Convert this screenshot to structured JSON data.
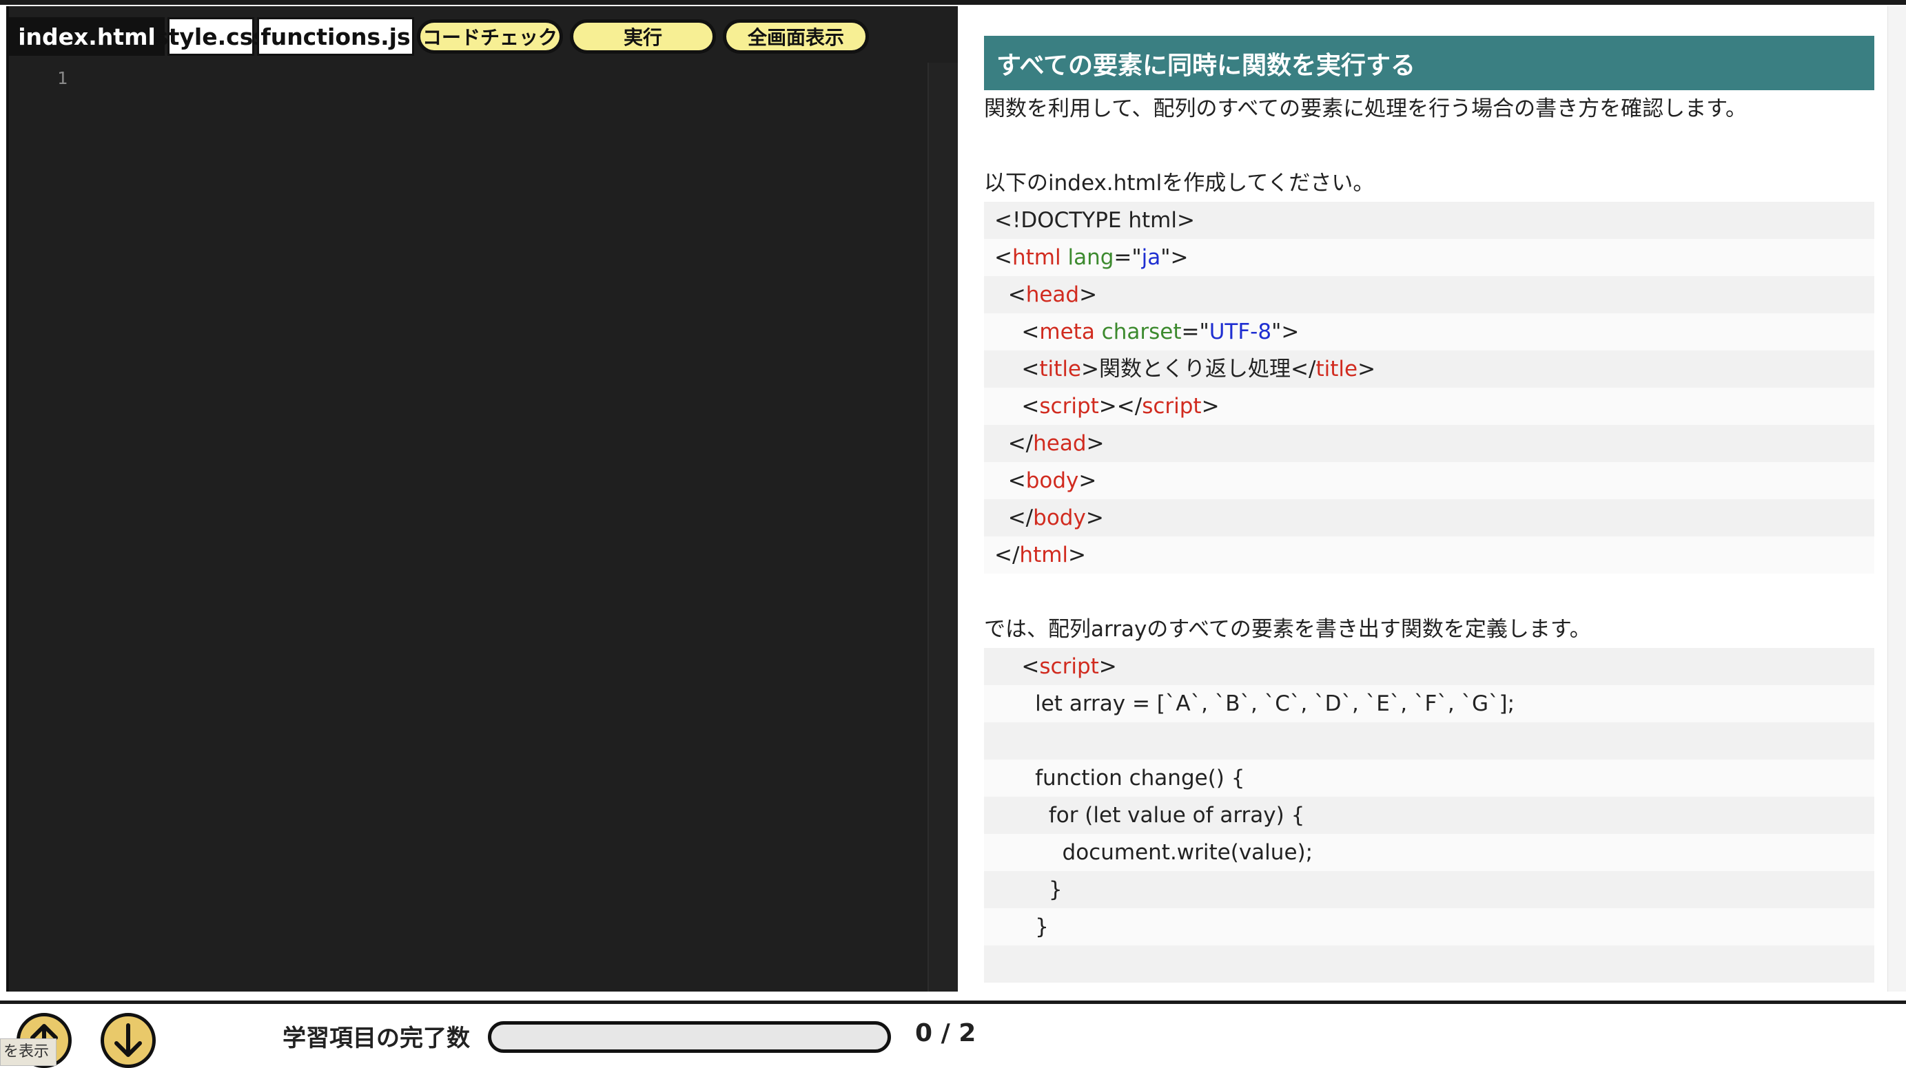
{
  "editor": {
    "tabs": [
      {
        "label": "index.html",
        "active": true
      },
      {
        "label": "style.css",
        "active": false
      },
      {
        "label": "functions.js",
        "active": false
      }
    ],
    "buttons": {
      "code_check": "コードチェック",
      "run": "実行",
      "fullscreen": "全画面表示"
    },
    "line_number": "1"
  },
  "doc": {
    "heading": "すべての要素に同時に関数を実行する",
    "intro": "関数を利用して、配列のすべての要素に処理を行う場合の書き方を確認します。",
    "instruction1": "以下のindex.htmlを作成してください。",
    "html_code": [
      [
        [
          "",
          "<!DOCTYPE html>"
        ]
      ],
      [
        [
          "",
          "<"
        ],
        [
          "tag",
          "html"
        ],
        [
          "",
          " "
        ],
        [
          "attr",
          "lang"
        ],
        [
          "",
          "=\""
        ],
        [
          "str",
          "ja"
        ],
        [
          "",
          "\">"
        ]
      ],
      [
        [
          "",
          "  <"
        ],
        [
          "tag",
          "head"
        ],
        [
          "",
          ">"
        ]
      ],
      [
        [
          "",
          "    <"
        ],
        [
          "tag",
          "meta"
        ],
        [
          "",
          " "
        ],
        [
          "attr",
          "charset"
        ],
        [
          "",
          "=\""
        ],
        [
          "str",
          "UTF-8"
        ],
        [
          "",
          "\">"
        ]
      ],
      [
        [
          "",
          "    <"
        ],
        [
          "tag",
          "title"
        ],
        [
          "",
          ">関数とくり返し処理</"
        ],
        [
          "tag",
          "title"
        ],
        [
          "",
          ">"
        ]
      ],
      [
        [
          "",
          "    <"
        ],
        [
          "tag",
          "script"
        ],
        [
          "",
          "></"
        ],
        [
          "tag",
          "script"
        ],
        [
          "",
          ">"
        ]
      ],
      [
        [
          "",
          "  </"
        ],
        [
          "tag",
          "head"
        ],
        [
          "",
          ">"
        ]
      ],
      [
        [
          "",
          "  <"
        ],
        [
          "tag",
          "body"
        ],
        [
          "",
          ">"
        ]
      ],
      [
        [
          "",
          "  </"
        ],
        [
          "tag",
          "body"
        ],
        [
          "",
          ">"
        ]
      ],
      [
        [
          "",
          "</"
        ],
        [
          "tag",
          "html"
        ],
        [
          "",
          ">"
        ]
      ]
    ],
    "instruction2": "では、配列arrayのすべての要素を書き出す関数を定義します。",
    "script_code": [
      [
        [
          "",
          "    <"
        ],
        [
          "tag",
          "script"
        ],
        [
          "",
          ">"
        ]
      ],
      [
        [
          "",
          "      let array = [`A`, `B`, `C`, `D`, `E`, `F`, `G`];"
        ]
      ],
      [
        [
          "",
          ""
        ]
      ],
      [
        [
          "",
          "      function change() {"
        ]
      ],
      [
        [
          "",
          "        for (let value of array) {"
        ]
      ],
      [
        [
          "",
          "          document.write(value);"
        ]
      ],
      [
        [
          "",
          "        }"
        ]
      ],
      [
        [
          "",
          "      }"
        ]
      ],
      [
        [
          "",
          ""
        ]
      ]
    ]
  },
  "footer": {
    "show_label": "を表示",
    "progress_label": "学習項目の完了数",
    "progress_count": "0 / 2",
    "progress_fraction": 0,
    "up_icon": "arrow-up-icon",
    "down_icon": "arrow-down-icon"
  },
  "colors": {
    "heading_bg": "#3a7f82",
    "button_bg": "#f7ef94",
    "editor_bg": "#1f1f1f",
    "tag": "#d12b1f",
    "attr": "#3c8a2e",
    "string": "#1f2fd1"
  }
}
